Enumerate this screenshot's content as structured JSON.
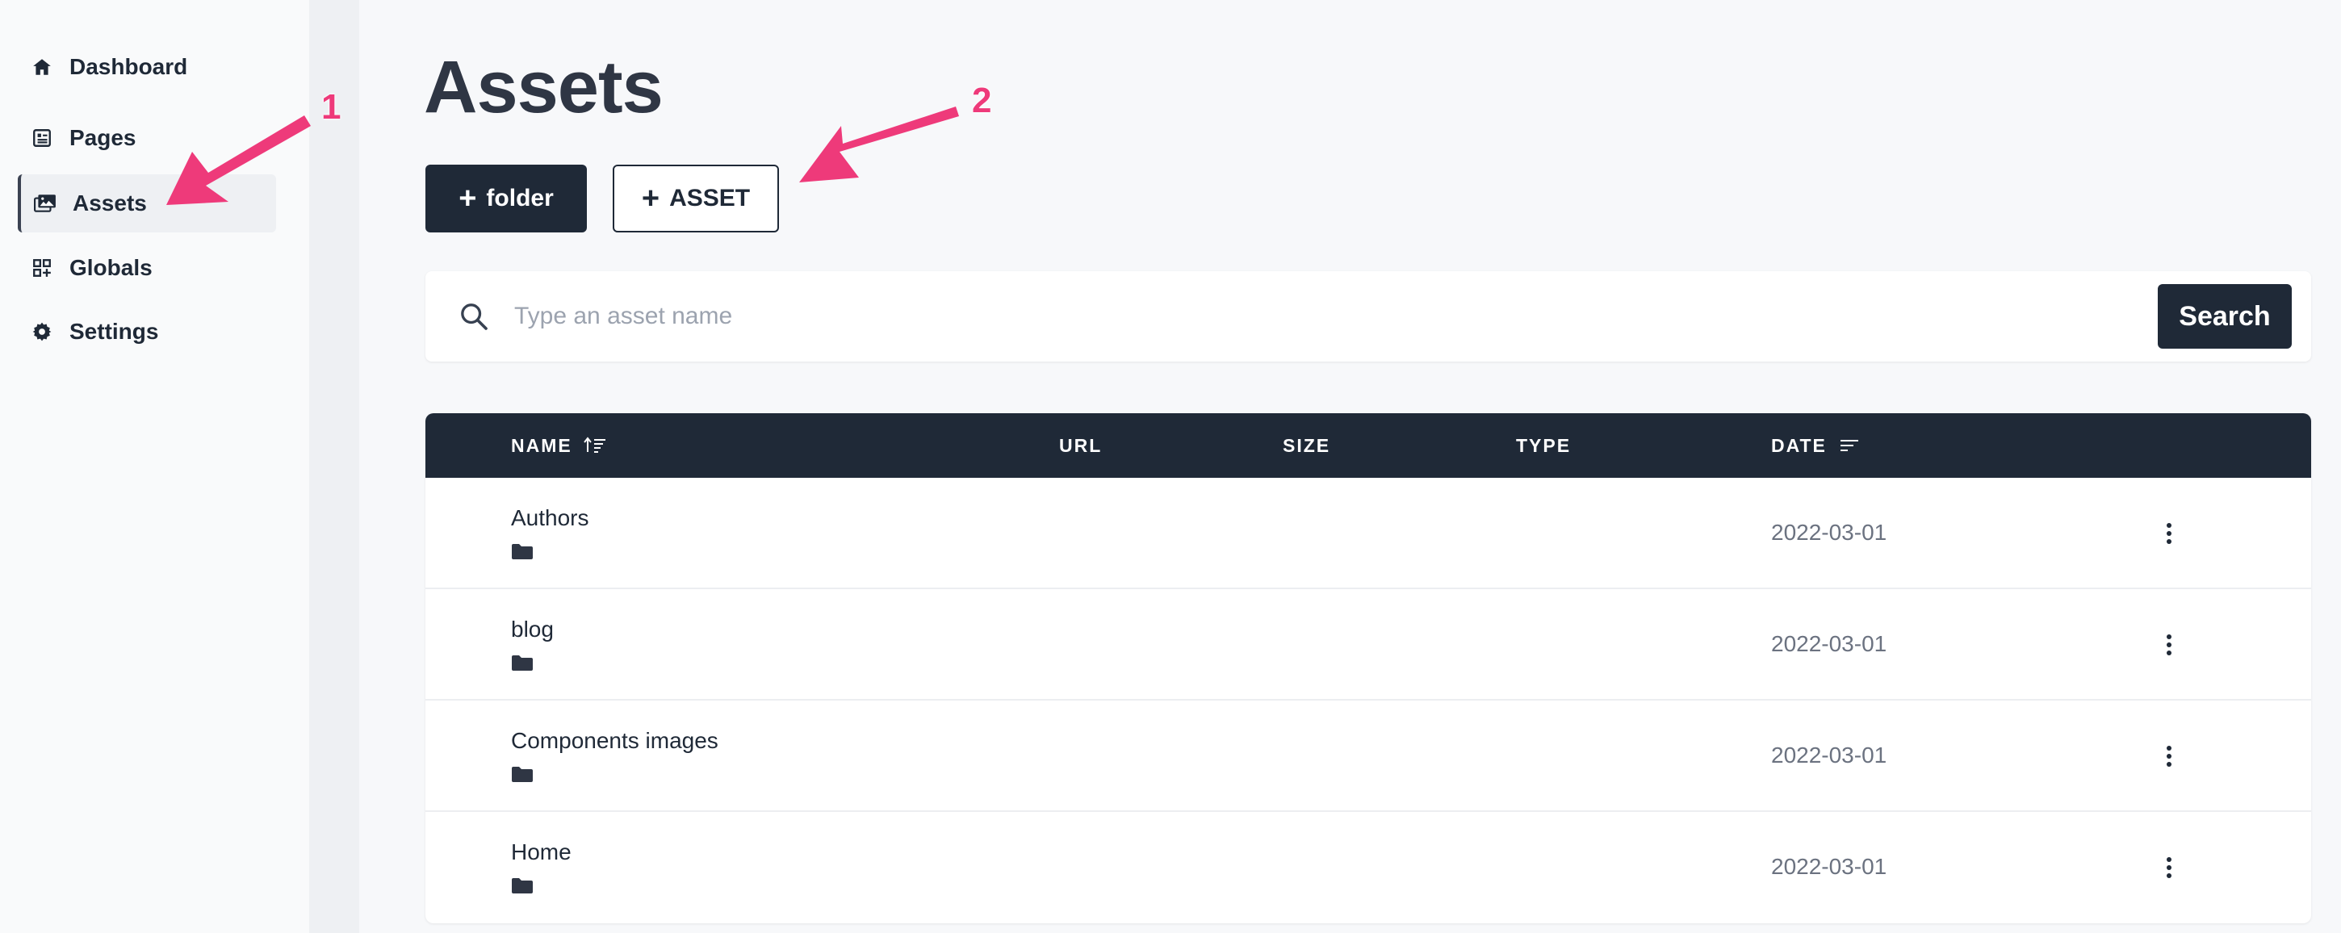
{
  "sidebar": {
    "items": [
      {
        "label": "Dashboard",
        "icon": "home-icon",
        "active": false
      },
      {
        "label": "Pages",
        "icon": "pages-icon",
        "active": false
      },
      {
        "label": "Assets",
        "icon": "image-icon",
        "active": true
      },
      {
        "label": "Globals",
        "icon": "grid-add-icon",
        "active": false
      },
      {
        "label": "Settings",
        "icon": "gear-icon",
        "active": false
      }
    ]
  },
  "main": {
    "title": "Assets",
    "buttons": {
      "folder_label": "folder",
      "asset_label": "ASSET",
      "plus_symbol": "+"
    },
    "search": {
      "placeholder": "Type an asset name",
      "value": "",
      "button_label": "Search"
    },
    "table": {
      "headers": {
        "name": "NAME",
        "url": "URL",
        "size": "SIZE",
        "type": "TYPE",
        "date": "DATE"
      },
      "rows": [
        {
          "name": "Authors",
          "kind": "folder",
          "date": "2022-03-01"
        },
        {
          "name": "blog",
          "kind": "folder",
          "date": "2022-03-01"
        },
        {
          "name": "Components images",
          "kind": "folder",
          "date": "2022-03-01"
        },
        {
          "name": "Home",
          "kind": "folder",
          "date": "2022-03-01"
        }
      ]
    }
  },
  "annotations": {
    "marker_1": "1",
    "marker_2": "2",
    "color": "#ee3a7a"
  },
  "colors": {
    "dark": "#1f2937",
    "sidebar_bg": "#f9fafb",
    "page_bg": "#f7f8fa"
  }
}
